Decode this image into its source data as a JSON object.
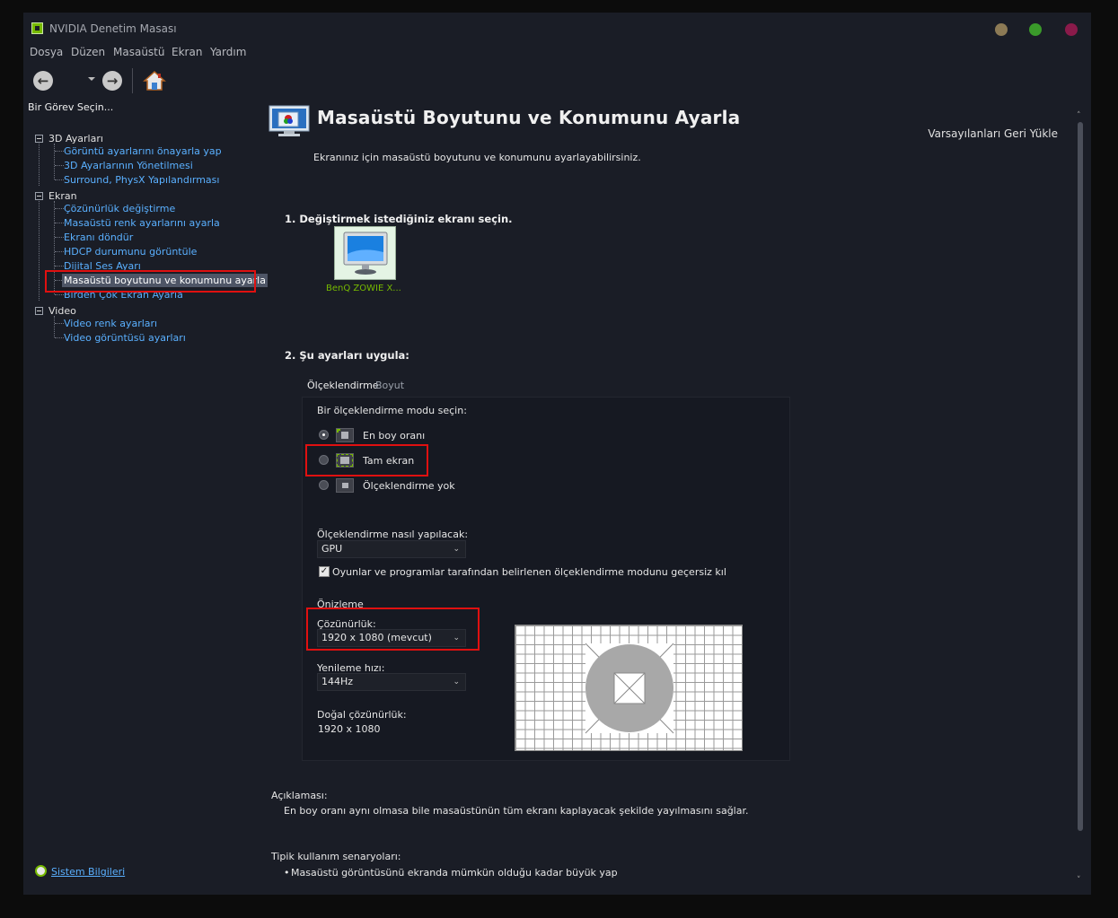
{
  "window": {
    "title": "NVIDIA Denetim Masası",
    "controls": {
      "minimize_color": "#8c7a55",
      "maximize_color": "#3a9a2a",
      "close_color": "#8a1a4a"
    }
  },
  "menu": [
    "Dosya",
    "Düzen",
    "Masaüstü",
    "Ekran",
    "Yardım"
  ],
  "toolbar": {
    "back_icon": "back-arrow-icon",
    "forward_icon": "forward-arrow-icon",
    "home_icon": "home-icon"
  },
  "sidebar": {
    "heading": "Bir Görev Seçin...",
    "groups": [
      {
        "label": "3D Ayarları",
        "items": [
          "Görüntü ayarlarını önayarla yap",
          "3D Ayarlarının Yönetilmesi",
          "Surround, PhysX Yapılandırması"
        ]
      },
      {
        "label": "Ekran",
        "items": [
          "Çözünürlük değiştirme",
          "Masaüstü renk ayarlarını ayarla",
          "Ekranı döndür",
          "HDCP durumunu görüntüle",
          "Dijital Ses Ayarı",
          "Masaüstü boyutunu ve konumunu ayarla",
          "Birden Çok Ekran Ayarla"
        ]
      },
      {
        "label": "Video",
        "items": [
          "Video renk ayarları",
          "Video görüntüsü ayarları"
        ]
      }
    ],
    "selected_item": "Masaüstü boyutunu ve konumunu ayarla",
    "system_info": "Sistem Bilgileri"
  },
  "main": {
    "title": "Masaüstü Boyutunu ve Konumunu Ayarla",
    "restore_defaults": "Varsayılanları Geri Yükle",
    "intro": "Ekranınız için masaüstü boyutunu ve konumunu ayarlayabilirsiniz.",
    "step1": "1. Değiştirmek istediğiniz ekranı seçin.",
    "monitor_label": "BenQ ZOWIE X...",
    "step2": "2. Şu ayarları uygula:",
    "tabs": [
      "Ölçeklendirme",
      "Boyut"
    ],
    "active_tab": "Ölçeklendirme",
    "scaling_prompt": "Bir ölçeklendirme modu seçin:",
    "scaling_modes": [
      {
        "label": "En boy oranı",
        "checked": true
      },
      {
        "label": "Tam ekran",
        "checked": false
      },
      {
        "label": "Ölçeklendirme yok",
        "checked": false
      }
    ],
    "scaling_how_label": "Ölçeklendirme nasıl yapılacak:",
    "scaling_how_value": "GPU",
    "override_label": "Oyunlar ve programlar tarafından belirlenen ölçeklendirme modunu geçersiz kıl",
    "override_checked": true,
    "preview_label": "Önizleme",
    "resolution_label": "Çözünürlük:",
    "resolution_value": "1920 x 1080 (mevcut)",
    "refresh_label": "Yenileme hızı:",
    "refresh_value": "144Hz",
    "native_label": "Doğal çözünürlük:",
    "native_value": "1920 x 1080",
    "description_heading": "Açıklaması:",
    "description_text": "En boy oranı aynı olmasa bile masaüstünün tüm ekranı kaplayacak şekilde yayılmasını sağlar.",
    "usage_heading": "Tipik kullanım senaryoları:",
    "usage_item": "Masaüstü görüntüsünü ekranda mümkün olduğu kadar büyük yap"
  },
  "colors": {
    "accent_green": "#76b900",
    "link_blue": "#5ab0ff",
    "highlight_red": "#e01010"
  }
}
